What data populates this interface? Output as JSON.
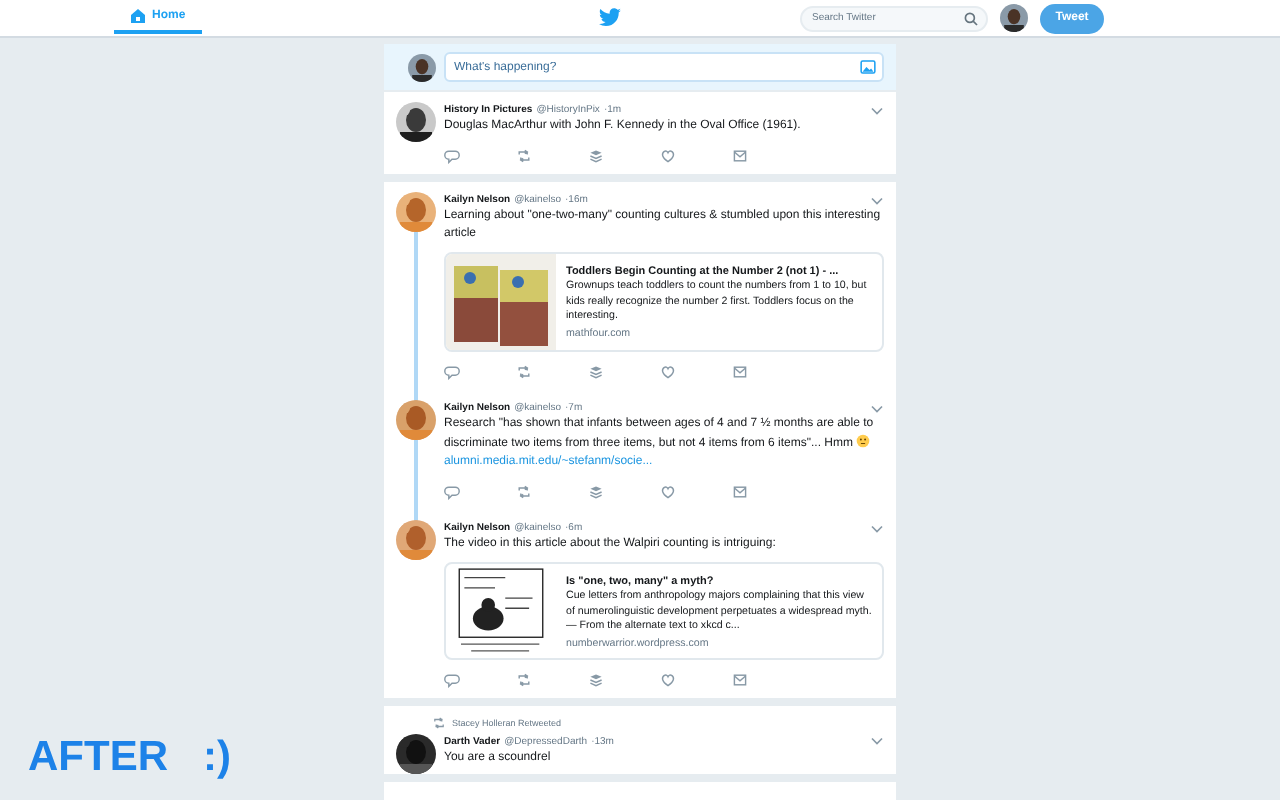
{
  "header": {
    "home_tab": {
      "label": "Home",
      "selected": true
    },
    "search": {
      "placeholder": "Search Twitter"
    },
    "tweet_button": "Tweet"
  },
  "compose": {
    "placeholder": "What's happening?"
  },
  "tweets": [
    {
      "name": "History In Pictures",
      "handle": "@HistoryInPix",
      "time": "·1m",
      "text": "Douglas MacArthur with John F. Kennedy in the Oval Office (1961).",
      "thread": false
    },
    {
      "name": "Kailyn Nelson",
      "handle": "@kainelso",
      "time": "·16m",
      "text": "Learning about \"one-two-many\" counting cultures & stumbled upon this interesting article",
      "thread": true,
      "card": {
        "title": "Toddlers Begin Counting at the Number 2 (not 1) - ...",
        "text": "Grownups teach toddlers to count the numbers from 1 to 10, but kids really recognize the number 2 first. Toddlers focus on the interesting.",
        "domain": "mathfour.com"
      }
    },
    {
      "name": "Kailyn Nelson",
      "handle": "@kainelso",
      "time": "·7m",
      "text": "Research \"has shown that infants between ages of 4 and 7 ½ months are able to discriminate two items from three items, but not 4 items from 6 items\"... Hmm",
      "thinking_emoji": true,
      "link": "alumni.media.mit.edu/~stefanm/socie...",
      "thread": true
    },
    {
      "name": "Kailyn Nelson",
      "handle": "@kainelso",
      "time": "·6m",
      "text": "The video in this article about the Walpiri counting is intriguing:",
      "thread": false,
      "card": {
        "title": "Is \"one, two, many\" a myth?",
        "text": "Cue letters from anthropology majors complaining that this view of numerolinguistic development perpetuates a widespread myth. — From the alternate text to xkcd c...",
        "domain": "numberwarrior.wordpress.com"
      }
    },
    {
      "retweeted_by": "Stacey Holleran Retweeted",
      "name": "Darth Vader",
      "handle": "@DepressedDarth",
      "time": "·13m",
      "text": "You are a scoundrel",
      "thread": false
    }
  ],
  "caption": "AFTER   :)"
}
